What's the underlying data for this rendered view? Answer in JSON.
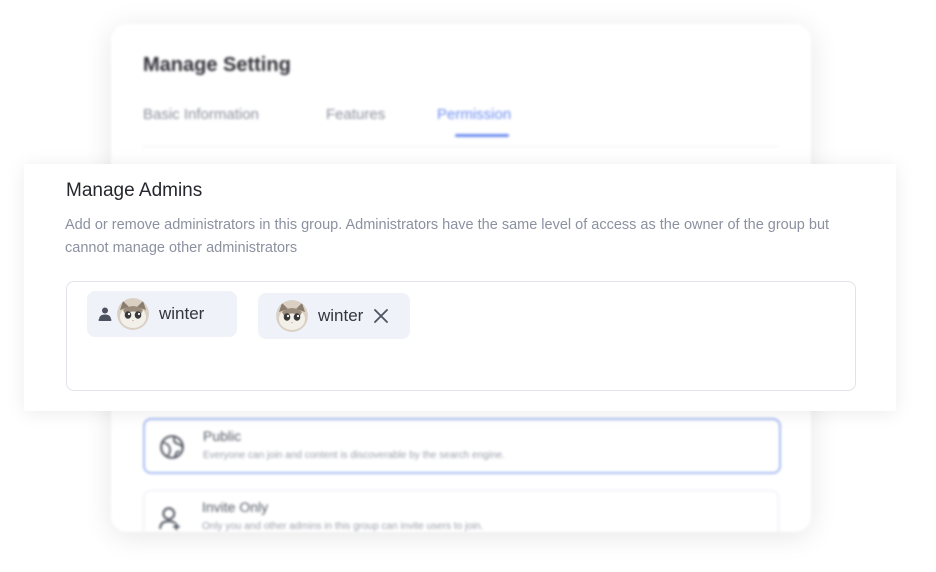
{
  "background_card": {
    "title": "Manage  Setting",
    "tabs": [
      {
        "label": "Basic Information",
        "active": false
      },
      {
        "label": "Features",
        "active": false
      },
      {
        "label": "Permission",
        "active": true
      }
    ],
    "options": [
      {
        "title": "Public",
        "description": "Everyone can join and content is discoverable by the search engine.",
        "icon": "globe-icon",
        "selected": true
      },
      {
        "title": "Invite Only",
        "description": "Only you and other admins in this group can invite users to join.",
        "icon": "user-add-icon",
        "selected": false
      }
    ]
  },
  "panel": {
    "title": "Manage Admins",
    "description": "Add or remove administrators in this group. Administrators have the same level of access as the owner of the group but cannot manage other administrators",
    "admins": [
      {
        "name": "winter",
        "role": "owner",
        "icon": "owner-icon",
        "removable": false
      },
      {
        "name": "winter",
        "role": "admin",
        "removable": true,
        "remove_icon": "close-icon"
      }
    ]
  },
  "colors": {
    "accent": "#6e8ef0",
    "chip_bg": "#eff2f8",
    "muted_text": "#8b91a0"
  }
}
